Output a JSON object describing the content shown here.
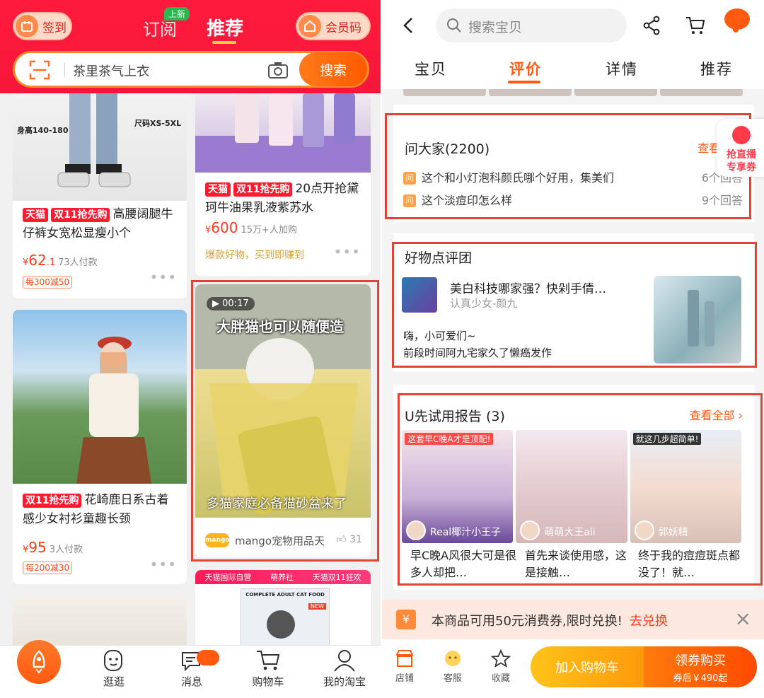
{
  "left": {
    "header": {
      "signin": "签到",
      "subscribe": "订阅",
      "new_badge": "上新",
      "recommend": "推荐",
      "vip_code": "会员码",
      "search_value": "茶里茶气上衣",
      "search_button": "搜索"
    },
    "feed": {
      "card1": {
        "tags": [
          "天猫",
          "双11抢先购"
        ],
        "title": "高腰阔腿牛仔裤女宽松显瘦小个",
        "price_sym": "¥",
        "price_int": "62",
        "price_dec": ".1",
        "sold": "73人付款",
        "coupon": "每300减50",
        "img_text_a": "身高140-180",
        "img_text_b": "尺码XS-5XL"
      },
      "card2": {
        "tags": [
          "天猫",
          "双11抢先购"
        ],
        "title": "20点开抢黛珂牛油果乳液紫苏水",
        "price_sym": "¥",
        "price_int": "600",
        "sold": "15万+人加购",
        "hot": "爆款好物，买到即赚到"
      },
      "card3": {
        "tags": [
          "双11抢先购"
        ],
        "title": "花崎鹿日系古着感少女衬衫童趣长颈",
        "price_sym": "¥",
        "price_int": "95",
        "sold": "3人付款",
        "coupon": "每200减30"
      },
      "video": {
        "duration": "00:17",
        "caption_top": "大胖猫也可以随便造",
        "caption_bottom": "多猫家庭必备猫砂盆来了",
        "shop_logo": "mango",
        "shop": "mango宠物用品天",
        "likes": "31"
      },
      "banner_strip": [
        "天猫国际自营",
        "萌养社",
        "天猫双11狂欢"
      ],
      "cat_food_label": "COMPLETE ADULT CAT FOOD",
      "cat_food_new": "NEW"
    },
    "bottom_nav": [
      {
        "label": "逛逛"
      },
      {
        "label": "消息"
      },
      {
        "label": "购物车"
      },
      {
        "label": "我的淘宝"
      }
    ]
  },
  "right": {
    "header": {
      "search_placeholder": "搜索宝贝",
      "tabs": [
        "宝贝",
        "评价",
        "详情",
        "推荐"
      ],
      "active_tab": "评价"
    },
    "ask": {
      "title": "问大家(2200)",
      "see_all": "查看全部",
      "q_icon": "问",
      "questions": [
        {
          "q": "这个和小灯泡科颜氏哪个好用，集美们",
          "count": "6个回答"
        },
        {
          "q": "这个淡痘印怎么样",
          "count": "9个回答"
        }
      ]
    },
    "live_float": {
      "line1": "抢直播",
      "line2": "专享券"
    },
    "goodies": {
      "title": "好物点评团",
      "post_title": "美白科技哪家强？快剁手倩…",
      "author": "认真少女-颜九",
      "body_1": "嗨，小可爱们~",
      "body_2": "前段时间阿九宅家久了懒癌发作"
    },
    "report": {
      "title": "U先试用报告 (3)",
      "see_all": "查看全部 ›",
      "items": [
        {
          "cap": "这套早C晚A才是顶配!",
          "name": "Real椰汁小王子",
          "desc": "早C晚A风很大可是很多人却把…"
        },
        {
          "cap": "",
          "name": "萌萌大王ali",
          "desc": "首先来谈使用感，这是接触…"
        },
        {
          "cap": "就这几步超简单!",
          "name": "郭妖精",
          "desc": "终于我的痘痘斑点都没了！就…"
        }
      ]
    },
    "voucher": {
      "icon": "¥",
      "text": "本商品可用50元消费券,限时兑换!",
      "action": "去兑换",
      "close": "×"
    },
    "bottom": {
      "store": "店铺",
      "service": "客服",
      "favorite": "收藏",
      "add_cart": "加入购物车",
      "buy": "领券购买",
      "buy_sub": "券后￥490起"
    }
  },
  "colors": {
    "brand_red": "#ff1a3c",
    "accent_orange": "#ff5a10",
    "highlight": "#e34234"
  }
}
